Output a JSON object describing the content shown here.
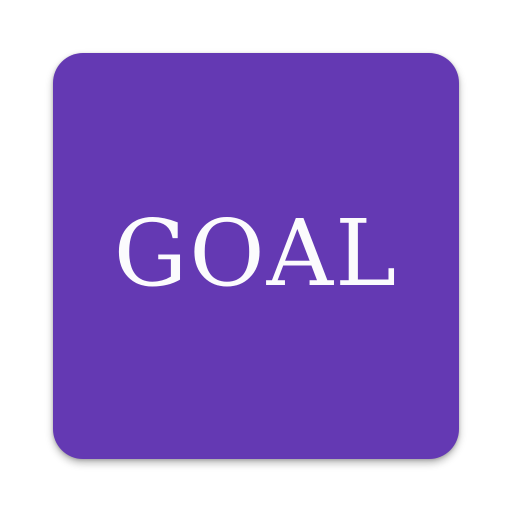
{
  "app_icon": {
    "label": "GOAL",
    "background_color": "#6439b3",
    "text_color": "#fbfbfd"
  }
}
